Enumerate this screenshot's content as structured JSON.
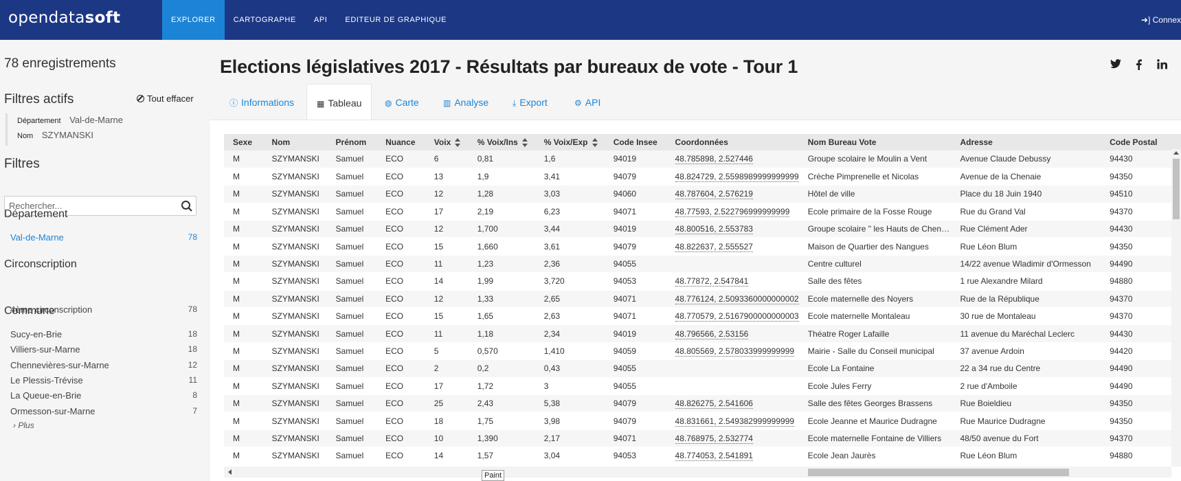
{
  "header": {
    "logo_light": "opendata",
    "logo_bold": "soft",
    "nav": [
      "EXPLORER",
      "CARTOGRAPHE",
      "API",
      "EDITEUR DE GRAPHIQUE"
    ],
    "connect": "Connex"
  },
  "sidebar": {
    "count": "78 enregistrements",
    "active_filters_title": "Filtres actifs",
    "clear_all": "Tout effacer",
    "active_filters": [
      {
        "key": "Département",
        "value": "Val-de-Marne"
      },
      {
        "key": "Nom",
        "value": "SZYMANSKI"
      }
    ],
    "filters_title": "Filtres",
    "search_placeholder": "Rechercher...",
    "facets": [
      {
        "title": "Département",
        "items": [
          {
            "label": "Val-de-Marne",
            "count": "78"
          }
        ]
      },
      {
        "title": "Circonscription",
        "items": [
          {
            "label": "4ème circonscription",
            "count": "78"
          }
        ]
      },
      {
        "title": "Commune",
        "items": [
          {
            "label": "Sucy-en-Brie",
            "count": "18"
          },
          {
            "label": "Villiers-sur-Marne",
            "count": "18"
          },
          {
            "label": "Chennevières-sur-Marne",
            "count": "12"
          },
          {
            "label": "Le Plessis-Trévise",
            "count": "11"
          },
          {
            "label": "La Queue-en-Brie",
            "count": "8"
          },
          {
            "label": "Ormesson-sur-Marne",
            "count": "7"
          }
        ]
      }
    ],
    "more": "Plus"
  },
  "main": {
    "title": "Elections législatives 2017 - Résultats par bureaux de vote - Tour 1",
    "social": [
      "twitter",
      "facebook",
      "linkedin"
    ],
    "tabs": [
      "Informations",
      "Tableau",
      "Carte",
      "Analyse",
      "Export",
      "API"
    ],
    "active_tab": "Tableau",
    "table": {
      "headers": [
        "Sexe",
        "Nom",
        "Prénom",
        "Nuance",
        "Voix",
        "% Voix/Ins",
        "% Voix/Exp",
        "Code Insee",
        "Coordonnées",
        "Nom Bureau Vote",
        "Adresse",
        "Code Postal"
      ],
      "rows": [
        [
          "M",
          "SZYMANSKI",
          "Samuel",
          "ECO",
          "6",
          "0,81",
          "1,6",
          "94019",
          "48.785898, 2.527446",
          "Groupe scolaire le Moulin a Vent",
          "Avenue Claude Debussy",
          "94430"
        ],
        [
          "M",
          "SZYMANSKI",
          "Samuel",
          "ECO",
          "13",
          "1,9",
          "3,41",
          "94079",
          "48.824729, 2.5598989999999999",
          "Crèche Pimprenelle et Nicolas",
          "Avenue de la Chenaie",
          "94350"
        ],
        [
          "M",
          "SZYMANSKI",
          "Samuel",
          "ECO",
          "12",
          "1,28",
          "3,03",
          "94060",
          "48.787604, 2.576219",
          "Hôtel de ville",
          "Place du 18 Juin 1940",
          "94510"
        ],
        [
          "M",
          "SZYMANSKI",
          "Samuel",
          "ECO",
          "17",
          "2,19",
          "6,23",
          "94071",
          "48.77593, 2.522796999999999",
          "Ecole primaire de la Fosse Rouge",
          "Rue du Grand Val",
          "94370"
        ],
        [
          "M",
          "SZYMANSKI",
          "Samuel",
          "ECO",
          "12",
          "1,700",
          "3,44",
          "94019",
          "48.800516, 2.553783",
          "Groupe scolaire \" les Hauts de Chen…",
          "Rue Clément Ader",
          "94430"
        ],
        [
          "M",
          "SZYMANSKI",
          "Samuel",
          "ECO",
          "15",
          "1,660",
          "3,61",
          "94079",
          "48.822637, 2.555527",
          "Maison de Quartier des Nangues",
          "Rue Léon Blum",
          "94350"
        ],
        [
          "M",
          "SZYMANSKI",
          "Samuel",
          "ECO",
          "11",
          "1,23",
          "2,36",
          "94055",
          "",
          "Centre culturel",
          "14/22 avenue Wladimir d'Ormesson",
          "94490"
        ],
        [
          "M",
          "SZYMANSKI",
          "Samuel",
          "ECO",
          "14",
          "1,99",
          "3,720",
          "94053",
          "48.77872, 2.547841",
          "Salle des fêtes",
          "1 rue Alexandre Milard",
          "94880"
        ],
        [
          "M",
          "SZYMANSKI",
          "Samuel",
          "ECO",
          "12",
          "1,33",
          "2,65",
          "94071",
          "48.776124, 2.5093360000000002",
          "Ecole maternelle des Noyers",
          "Rue de la République",
          "94370"
        ],
        [
          "M",
          "SZYMANSKI",
          "Samuel",
          "ECO",
          "15",
          "1,65",
          "2,63",
          "94071",
          "48.770579, 2.5167900000000003",
          "Ecole maternelle Montaleau",
          "30 rue de Montaleau",
          "94370"
        ],
        [
          "M",
          "SZYMANSKI",
          "Samuel",
          "ECO",
          "11",
          "1,18",
          "2,34",
          "94019",
          "48.796566, 2.53156",
          "Théatre Roger Lafaille",
          "11 avenue du Maréchal Leclerc",
          "94430"
        ],
        [
          "M",
          "SZYMANSKI",
          "Samuel",
          "ECO",
          "5",
          "0,570",
          "1,410",
          "94059",
          "48.805569, 2.578033999999999",
          "Mairie - Salle du Conseil municipal",
          "37 avenue Ardoin",
          "94420"
        ],
        [
          "M",
          "SZYMANSKI",
          "Samuel",
          "ECO",
          "2",
          "0,2",
          "0,43",
          "94055",
          "",
          "Ecole La Fontaine",
          "22 a 34 rue du Centre",
          "94490"
        ],
        [
          "M",
          "SZYMANSKI",
          "Samuel",
          "ECO",
          "17",
          "1,72",
          "3",
          "94055",
          "",
          "Ecole Jules Ferry",
          "2 rue d'Amboile",
          "94490"
        ],
        [
          "M",
          "SZYMANSKI",
          "Samuel",
          "ECO",
          "25",
          "2,43",
          "5,38",
          "94079",
          "48.826275, 2.541606",
          "Salle des fêtes Georges Brassens",
          "Rue Boieldieu",
          "94350"
        ],
        [
          "M",
          "SZYMANSKI",
          "Samuel",
          "ECO",
          "18",
          "1,75",
          "3,98",
          "94079",
          "48.831661, 2.549382999999999",
          "Ecole Jeanne et Maurice Dudragne",
          "Rue Maurice Dudragne",
          "94350"
        ],
        [
          "M",
          "SZYMANSKI",
          "Samuel",
          "ECO",
          "10",
          "1,390",
          "2,17",
          "94071",
          "48.768975, 2.532774",
          "Ecole maternelle Fontaine de Villiers",
          "48/50 avenue du Fort",
          "94370"
        ],
        [
          "M",
          "SZYMANSKI",
          "Samuel",
          "ECO",
          "14",
          "1,57",
          "3,04",
          "94053",
          "48.774053, 2.541891",
          "Ecole Jean Jaurès",
          "Rue Léon Blum",
          "94880"
        ]
      ]
    },
    "tooltip": "Paint"
  }
}
